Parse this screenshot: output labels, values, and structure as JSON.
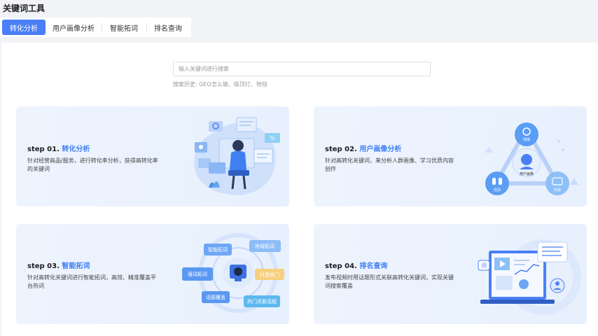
{
  "page": {
    "title": "关键词工具"
  },
  "tabs": [
    {
      "label": "转化分析"
    },
    {
      "label": "用户画像分析"
    },
    {
      "label": "智能拓词"
    },
    {
      "label": "排名查询"
    }
  ],
  "search": {
    "placeholder": "输入关键词进行搜索",
    "history": "搜索历史: GEO怎么做、吸顶灯、地毯"
  },
  "cards": [
    {
      "step": "step 01.",
      "title": "转化分析",
      "desc": "针对经营商品/服务，进行转化率分析，获得高转化率的关键词"
    },
    {
      "step": "step 02.",
      "title": "用户画像分析",
      "desc": "针对高转化关键词，来分析人群画像、学习优质内容创作",
      "nodes": {
        "center": "用户画像",
        "top": "地域",
        "left": "性别",
        "right": "年龄"
      }
    },
    {
      "step": "step 03.",
      "title": "智能拓词",
      "desc": "针对高转化关键词进行智能拓词，高效、精准覆盖平台热词",
      "bubbles": [
        "智能拓词",
        "地域拓词",
        "强词拓词",
        "抖音热门",
        "话题覆盖",
        "热门关联话题"
      ]
    },
    {
      "step": "step 04.",
      "title": "排名查询",
      "desc": "发布视频时用话题形式关联高转化关键词，实现关键词搜索覆盖",
      "badge": "词"
    }
  ],
  "colors": {
    "accent": "#4a7ff7",
    "highlight": "#3d7ef5"
  }
}
